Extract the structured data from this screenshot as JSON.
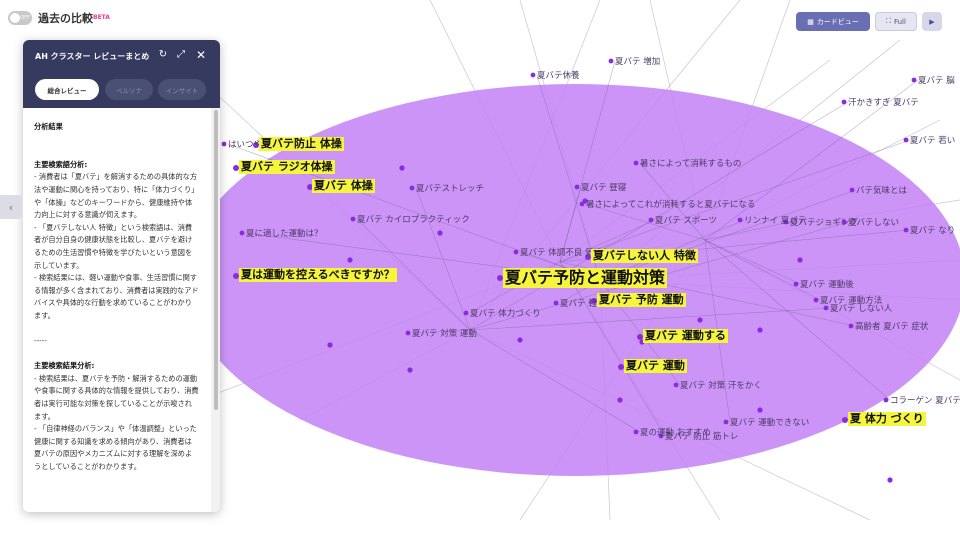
{
  "header": {
    "toggle_label": "OFF",
    "title": "過去の比較",
    "badge": "BETA",
    "card_view_label": "カードビュー",
    "full_label": "Full",
    "play_icon": "play-icon"
  },
  "panel": {
    "title": "AH クラスター レビューまとめ",
    "tabs": [
      "総合レビュー",
      "ペルソナ",
      "インサイト"
    ],
    "section1_title": "分析結果",
    "section2_title": "主要検索語分析:",
    "section2_paragraphs": [
      "- 消費者は「夏バテ」を解消するための具体的な方法や運動に関心を持っており、特に「体力づくり」や「体操」などのキーワードから、健康維持や体力向上に対する意識が伺えます。",
      "- 「夏バテしない人 特徴」という検索語は、消費者が自分自身の健康状態を比較し、夏バテを避けるための生活習慣や特徴を学びたいという意図を示しています。",
      "- 検索結果には、軽い運動や食事、生活習慣に関する情報が多く含まれており、消費者は実践的なアドバイスや具体的な行動を求めていることがわかります。"
    ],
    "divider": "-----",
    "section3_title": "主要検索結果分析:",
    "section3_paragraphs": [
      "- 検索結果は、夏バテを予防・解消するための運動や食事に関する具体的な情報を提供しており、消費者は実行可能な対策を探していることが示唆されます。",
      "- 「自律神経のバランス」や「体温調整」といった健康に関する知識を求める傾向があり、消費者は夏バテの原因やメカニズムに対する理解を深めようとしていることがわかります。"
    ]
  },
  "graph": {
    "cluster_color": "#c27cf6",
    "node_color": "#8a2be2",
    "highlight_color": "#f5f53c",
    "highlighted_terms": [
      "夏バテ防止 体操",
      "夏バテ ラジオ体操",
      "夏バテ 体操",
      "夏は運動を控えるべきですか？",
      "夏バテ予防と運動対策",
      "夏バテしない人 特徴",
      "夏バテ 予防 運動",
      "夏バテ 運動する",
      "夏バテ 運動",
      "夏 体力 づくり"
    ],
    "outer_terms": [
      "夏バテ 増加",
      "夏バテ休養",
      "夏バテ 脳",
      "汗かきすぎ 夏バテ",
      "夏バテ 若い",
      "はいつやめ",
      "暑さによって消耗するもの",
      "夏バテストレッチ",
      "夏バテ 昼寝",
      "バテ気味とは",
      "暑さによってこれが消耗すると夏バテになる",
      "夏バテ カイロプラクティック",
      "夏バテ スポーツ",
      "リンナイ 夏バテ",
      "夏バテジョギング",
      "夏バテしない",
      "夏バテ なり",
      "夏バテ 体調不良 気持ち",
      "夏バテ 運動後",
      "夏バテ 対策 運動",
      "夏バテ 体力づくり",
      "夏バテ 軽い運動",
      "夏バテ 運動方法",
      "夏バテ しない人",
      "高齢者 夏バテ 症状",
      "夏バテ 対策 汗をかく",
      "夏バテ 運動できない",
      "夏の運動 おすすめ",
      "夏バテ 防止 筋トレ",
      "夏に適した運動は？",
      "コラーゲン 夏バテ"
    ]
  }
}
